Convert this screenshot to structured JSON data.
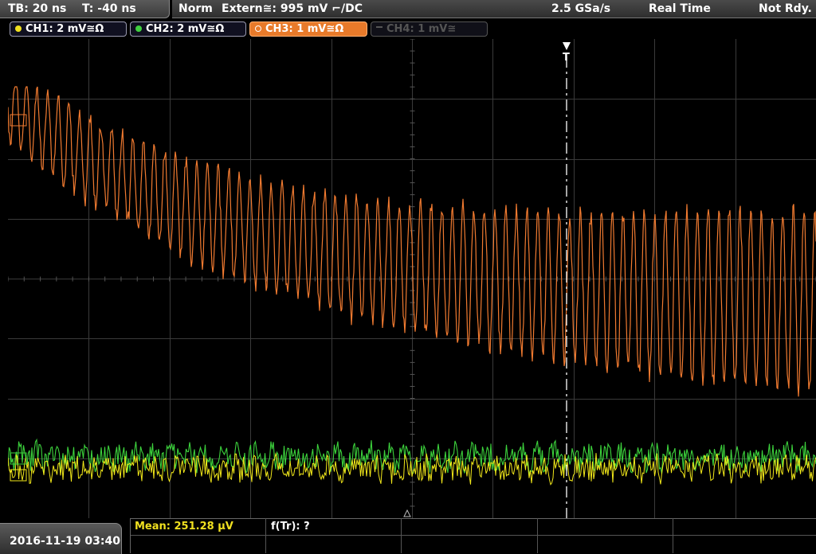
{
  "timebase": {
    "tb_label": "TB: 20 ns",
    "trigger_offset": "T: -40 ns"
  },
  "status": {
    "mode": "Norm",
    "trigger_source": "Extern≅: 995 mV ⌐/DC",
    "sample_rate": "2.5 GSa/s",
    "acq_mode": "Real Time",
    "state": "Not Rdy."
  },
  "channels": [
    {
      "label": "CH1: 2 mV≅Ω",
      "color": "#f0e020",
      "state": "on"
    },
    {
      "label": "CH2: 2 mV≅Ω",
      "color": "#40d040",
      "state": "on"
    },
    {
      "label": "CH3: 1 mV≅Ω",
      "color": "#ffffff",
      "state": "active"
    },
    {
      "label": "CH4: 1 mV≅",
      "color": "#555555",
      "state": "off"
    }
  ],
  "trigger_marker": "T",
  "colors": {
    "ch1": "#f2e81a",
    "ch2": "#3cd23c",
    "ch3": "#f07a30",
    "grid": "#3a3a3a"
  },
  "measurements": {
    "mean_label": "Mean: 251.28 µV",
    "freq_label": "f(Tr): ?"
  },
  "datetime": "2016-11-19 03:40"
}
